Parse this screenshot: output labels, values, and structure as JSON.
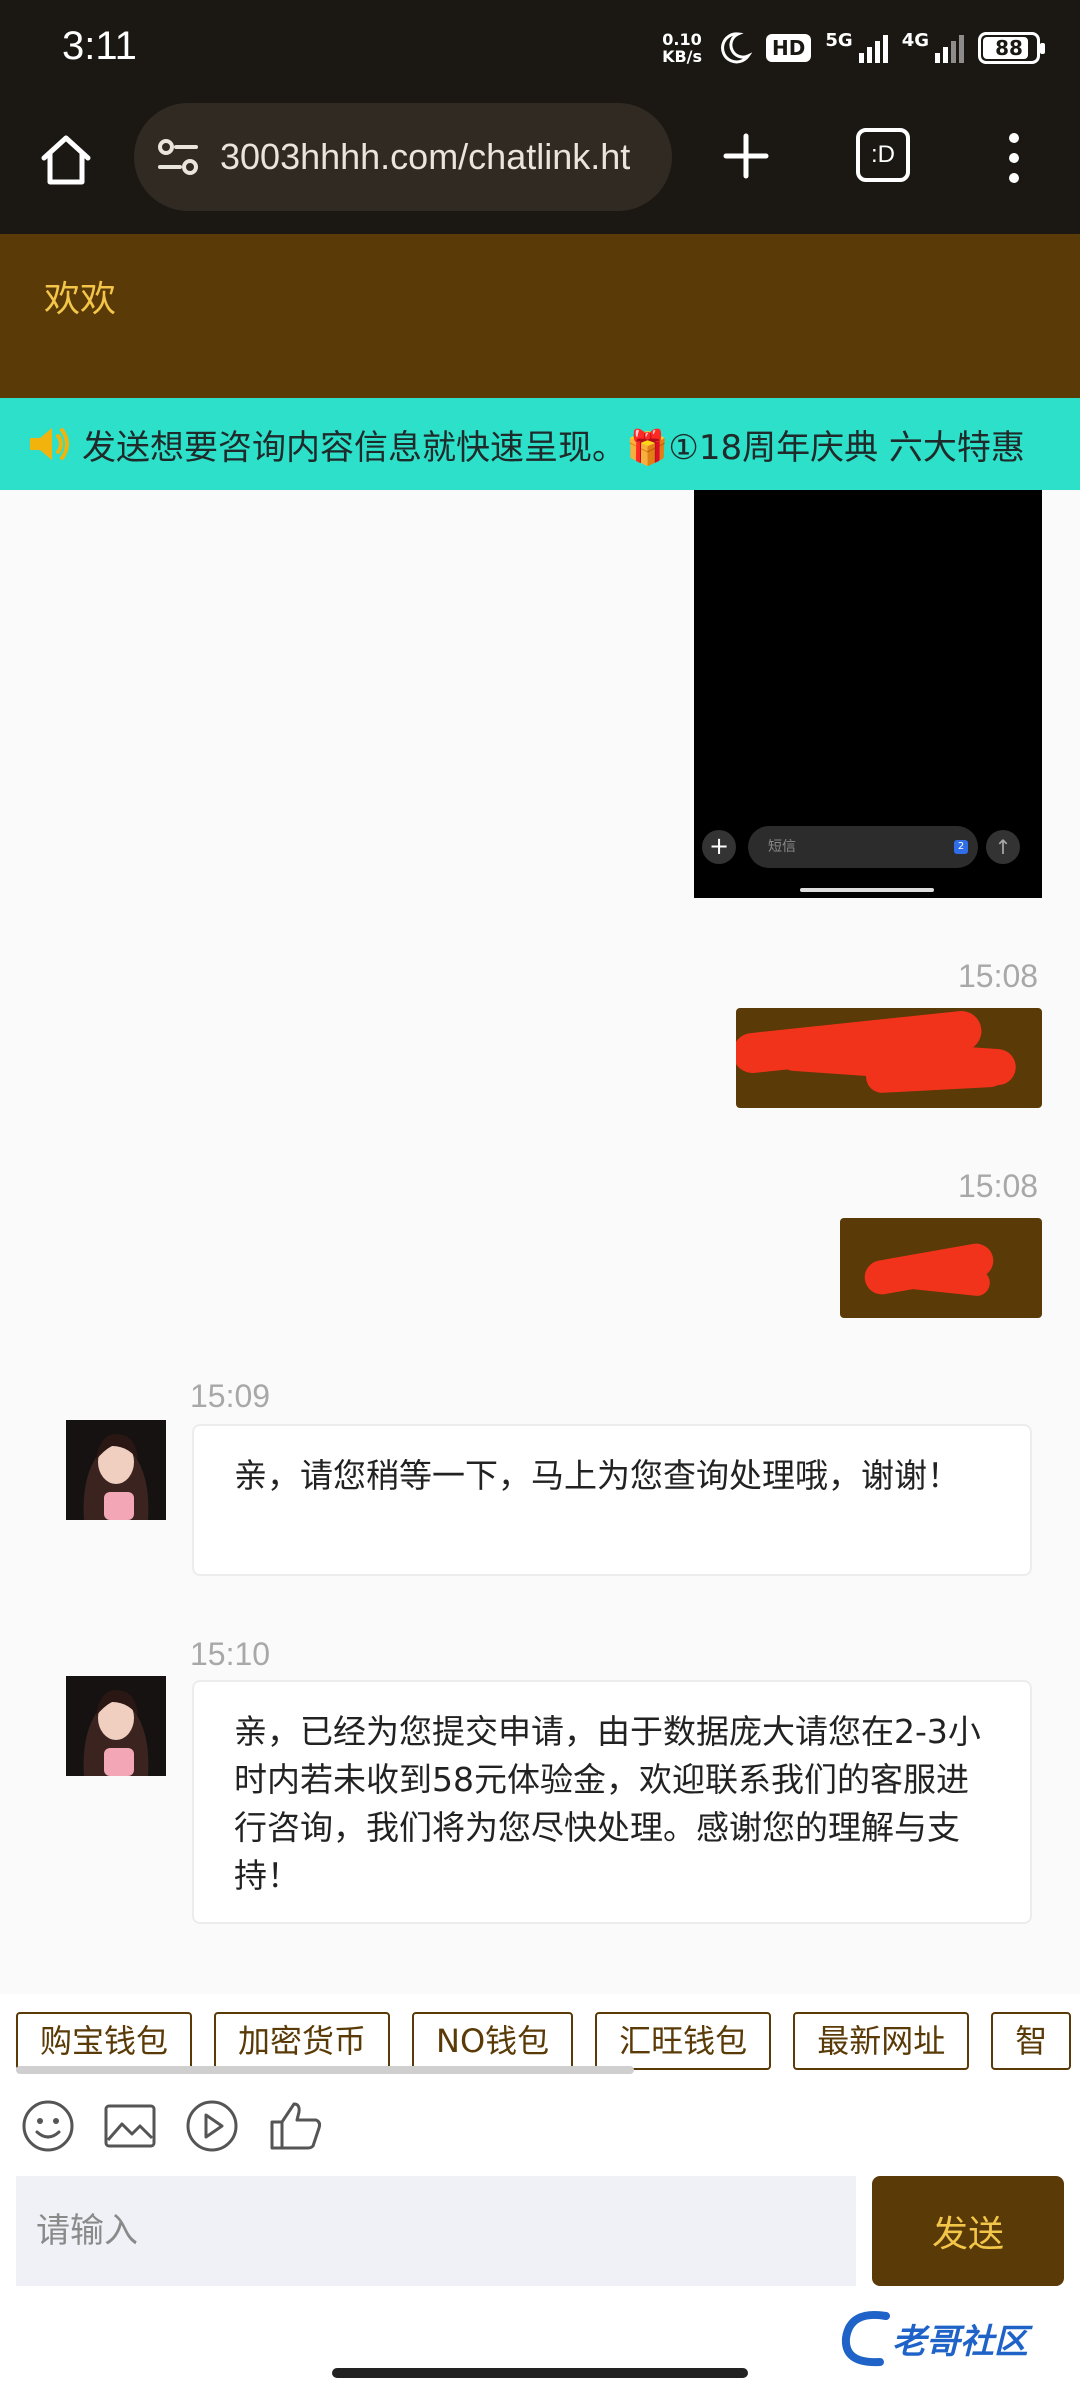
{
  "status_bar": {
    "time": "3:11",
    "speed_value": "0.10",
    "speed_unit": "KB/s",
    "hd_label": "HD",
    "network_1": "5G",
    "network_2": "4G",
    "battery": "88",
    "battery_level_percent": 88
  },
  "browser": {
    "url": "3003hhhh.com/chatlink.ht",
    "tabs_label": ":D"
  },
  "chat": {
    "title": "欢欢",
    "notice": "发送想要咨询内容信息就快速呈现。🎁①18周年庆典 六大特惠"
  },
  "phone_screenshot": {
    "input_hint": "短信",
    "badge": "2"
  },
  "messages": [
    {
      "time": "15:08",
      "direction": "out"
    },
    {
      "time": "15:08",
      "direction": "out"
    },
    {
      "time": "15:09",
      "direction": "in",
      "text": "亲，请您稍等一下，马上为您查询处理哦，谢谢！"
    },
    {
      "time": "15:10",
      "direction": "in",
      "text": "亲，已经为您提交申请，由于数据庞大请您在2-3小时内若未收到58元体验金，欢迎联系我们的客服进行咨询，我们将为您尽快处理。感谢您的理解与支持！"
    }
  ],
  "quick_buttons": [
    "购宝钱包",
    "加密货币",
    "NO钱包",
    "汇旺钱包",
    "最新网址",
    "智"
  ],
  "input": {
    "placeholder": "请输入",
    "send_label": "发送"
  },
  "colors": {
    "theme": "#5a3a06",
    "accent_text": "#f3c64a",
    "notice_bg": "#2de0c9",
    "redaction": "#f2331b"
  },
  "watermark": "老哥社区"
}
